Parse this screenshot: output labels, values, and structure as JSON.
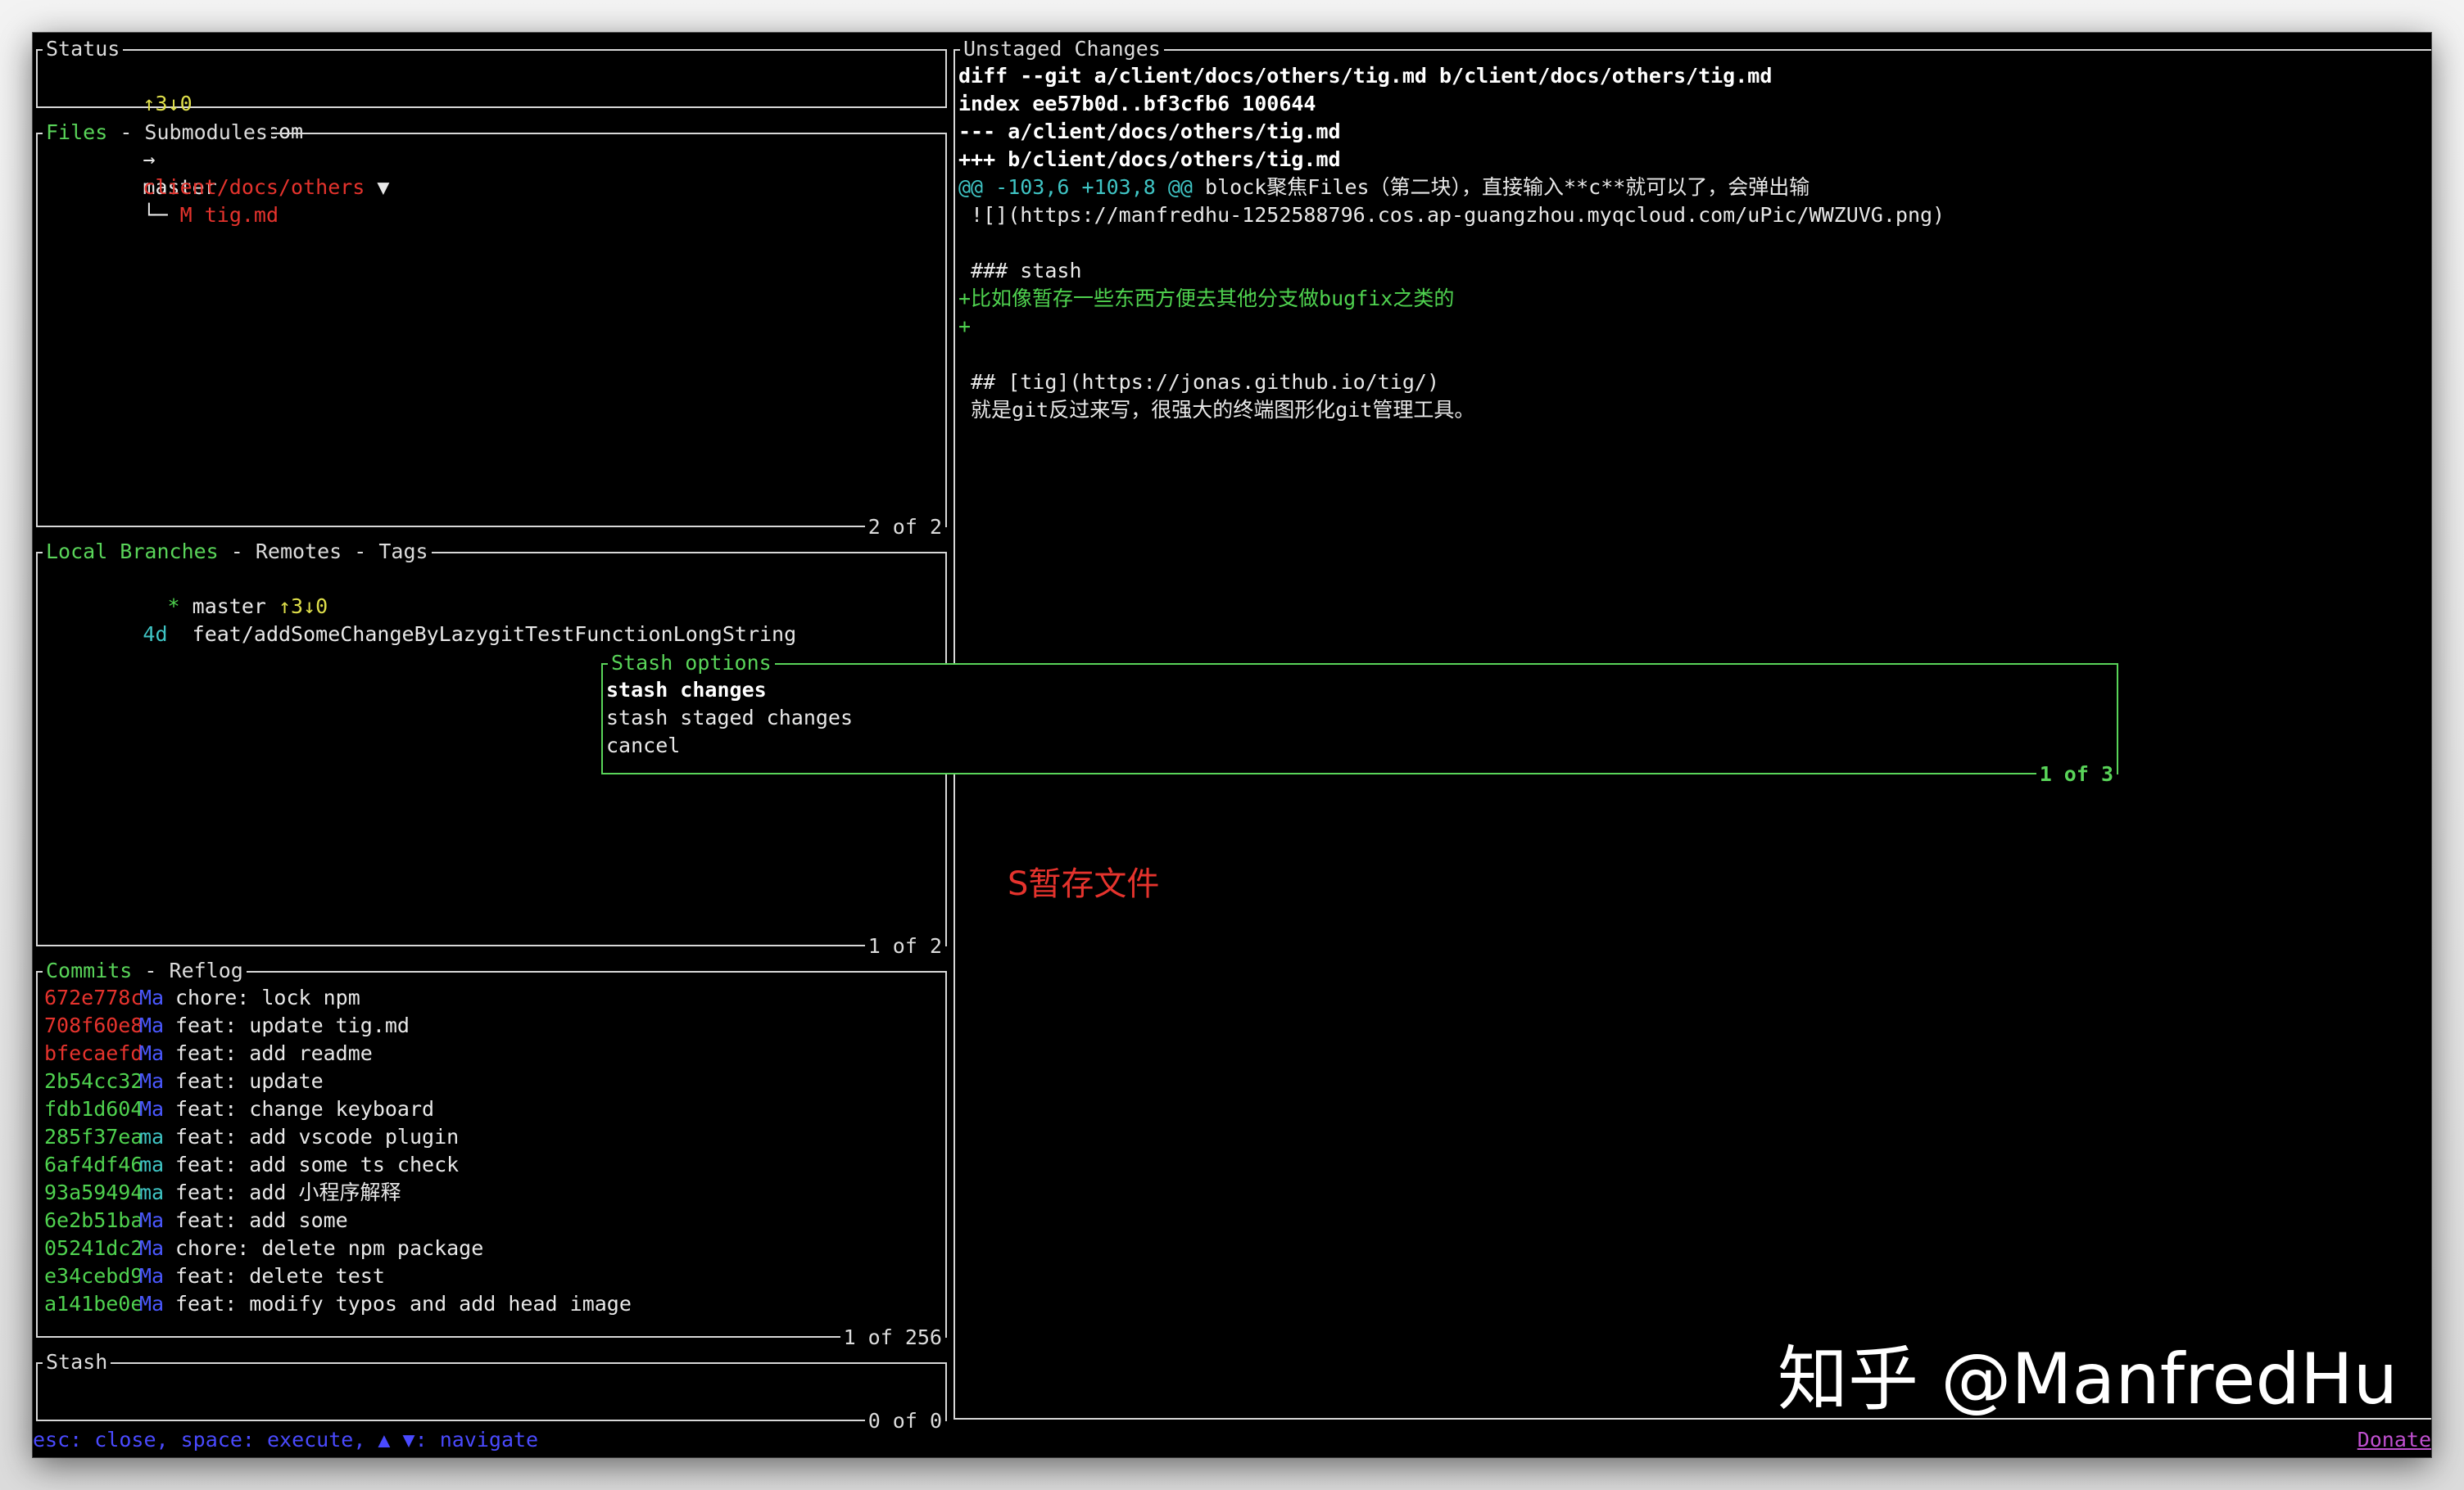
{
  "status": {
    "title": "Status",
    "ahead_behind": "↑3↓0",
    "repo": "manfredhu.com",
    "arrow": "→",
    "branch": "master"
  },
  "files": {
    "title_active": "Files",
    "title_rest": " - Submodules",
    "dir": "client/docs/others",
    "dir_chevron": "▼",
    "tree_connector": "└─",
    "file_status": "M",
    "file_name": "tig.md",
    "footer": "2 of 2"
  },
  "branches": {
    "title_active": "Local Branches",
    "title_rest": " - Remotes - Tags",
    "rows": [
      {
        "prefix": "  * ",
        "name": "master",
        "extra": " ↑3↓0"
      },
      {
        "prefix": "4d  ",
        "name": "feat/addSomeChangeByLazygitTestFunctionLongString",
        "extra": ""
      }
    ],
    "footer": "1 of 2"
  },
  "commits": {
    "title_active": "Commits",
    "title_rest": " - Reflog",
    "rows": [
      {
        "hash": "672e778c",
        "author": "Ma",
        "msg": "chore: lock npm",
        "hash_color": "red",
        "author_color": "blue"
      },
      {
        "hash": "708f60e8",
        "author": "Ma",
        "msg": "feat: update tig.md",
        "hash_color": "red",
        "author_color": "blue"
      },
      {
        "hash": "bfecaefd",
        "author": "Ma",
        "msg": "feat: add readme",
        "hash_color": "red",
        "author_color": "blue"
      },
      {
        "hash": "2b54cc32",
        "author": "Ma",
        "msg": "feat: update",
        "hash_color": "green",
        "author_color": "blue"
      },
      {
        "hash": "fdb1d604",
        "author": "Ma",
        "msg": "feat: change keyboard",
        "hash_color": "green",
        "author_color": "blue"
      },
      {
        "hash": "285f37ea",
        "author": "ma",
        "msg": "feat: add vscode plugin",
        "hash_color": "green",
        "author_color": "cyan"
      },
      {
        "hash": "6af4df46",
        "author": "ma",
        "msg": "feat: add some ts check",
        "hash_color": "green",
        "author_color": "cyan"
      },
      {
        "hash": "93a59494",
        "author": "ma",
        "msg": "feat: add 小程序解释",
        "hash_color": "green",
        "author_color": "cyan"
      },
      {
        "hash": "6e2b51ba",
        "author": "Ma",
        "msg": "feat: add some",
        "hash_color": "green",
        "author_color": "blue"
      },
      {
        "hash": "05241dc2",
        "author": "Ma",
        "msg": "chore: delete npm package",
        "hash_color": "green",
        "author_color": "blue"
      },
      {
        "hash": "e34cebd9",
        "author": "Ma",
        "msg": "feat: delete test",
        "hash_color": "green",
        "author_color": "blue"
      },
      {
        "hash": "a141be0e",
        "author": "Ma",
        "msg": "feat: modify typos and add head image",
        "hash_color": "green",
        "author_color": "blue"
      }
    ],
    "footer": "1 of 256"
  },
  "stash": {
    "title": "Stash",
    "footer": "0 of 0"
  },
  "diff": {
    "title": "Unstaged Changes",
    "lines": [
      {
        "text": "diff --git a/client/docs/others/tig.md b/client/docs/others/tig.md",
        "style": "bold"
      },
      {
        "text": "index ee57b0d..bf3cfb6 100644",
        "style": "bold"
      },
      {
        "text": "--- a/client/docs/others/tig.md",
        "style": "bold"
      },
      {
        "text": "+++ b/client/docs/others/tig.md",
        "style": "bold"
      },
      {
        "text": "@@ -103,6 +103,8 @@ block聚焦Files（第二块），直接输入**c**就可以了，会弹出输",
        "style": "hunk"
      },
      {
        "text": " ![](https://manfredhu-1252588796.cos.ap-guangzhou.myqcloud.com/uPic/WWZUVG.png)",
        "style": "plain"
      },
      {
        "text": "",
        "style": "plain"
      },
      {
        "text": " ### stash",
        "style": "plain"
      },
      {
        "text": "+比如像暂存一些东西方便去其他分支做bugfix之类的",
        "style": "added"
      },
      {
        "text": "+",
        "style": "added"
      },
      {
        "text": "",
        "style": "plain"
      },
      {
        "text": " ## [tig](https://jonas.github.io/tig/)",
        "style": "plain"
      },
      {
        "text": " 就是git反过来写，很强大的终端图形化git管理工具。",
        "style": "plain"
      }
    ]
  },
  "popup": {
    "title": "Stash options",
    "options": [
      "stash changes",
      "stash staged changes",
      "cancel"
    ],
    "footer": "1 of 3"
  },
  "annotation": "S暂存文件",
  "watermark": "知乎 @ManfredHu",
  "statusbar": {
    "hints": "esc: close, space: execute, ▲ ▼: navigate",
    "donate": "Donate"
  }
}
